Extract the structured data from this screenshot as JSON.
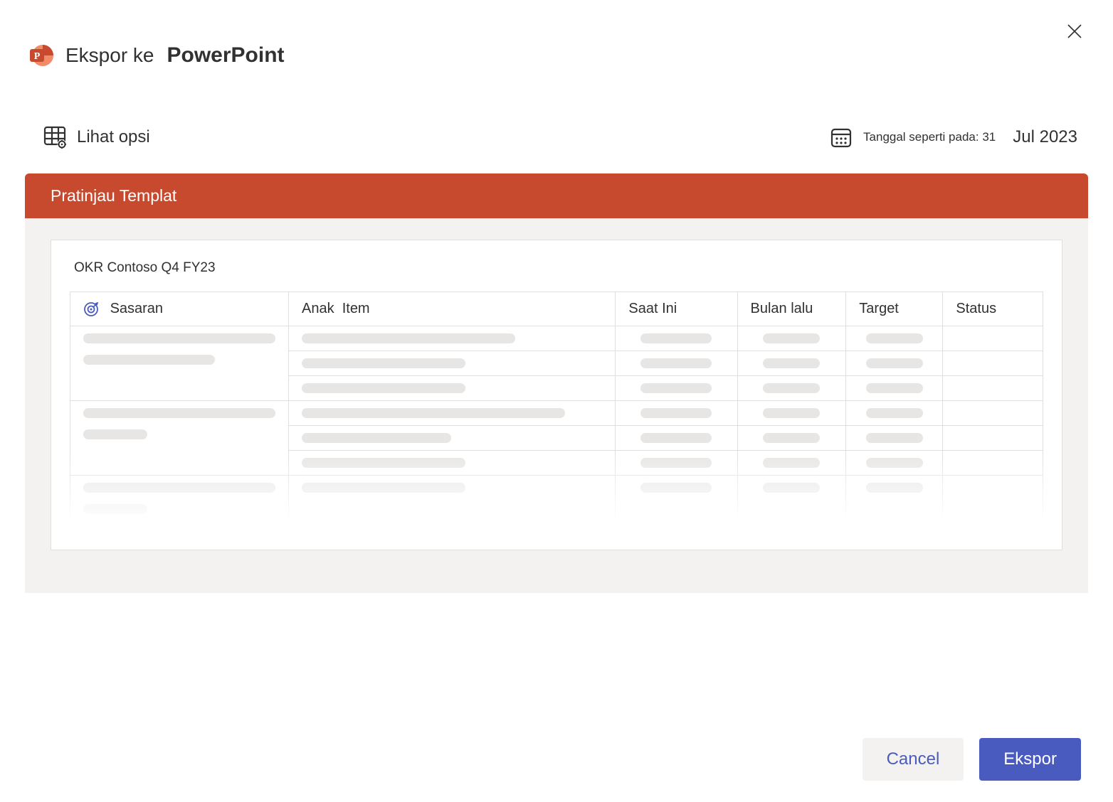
{
  "header": {
    "export_to_label": "Ekspor ke",
    "app_name": "PowerPoint"
  },
  "toolbar": {
    "view_options_label": "Lihat opsi",
    "date_prefix": "Tanggal seperti pada:",
    "date_day": "31",
    "date_month_year": "Jul 2023"
  },
  "preview": {
    "header_label": "Pratinjau Templat",
    "slide_title": "OKR Contoso Q4 FY23"
  },
  "columns": {
    "goal": "Sasaran",
    "child_item": "Anak  Item",
    "current": "Saat Ini",
    "last_month": "Bulan lalu",
    "target": "Target",
    "status": "Status"
  },
  "status_colors": {
    "green": "#c7e9c0",
    "red": "#f5c6c6",
    "yellow": "#f5e0a6"
  },
  "footer": {
    "cancel_label": "Cancel",
    "export_label": "Ekspor"
  }
}
